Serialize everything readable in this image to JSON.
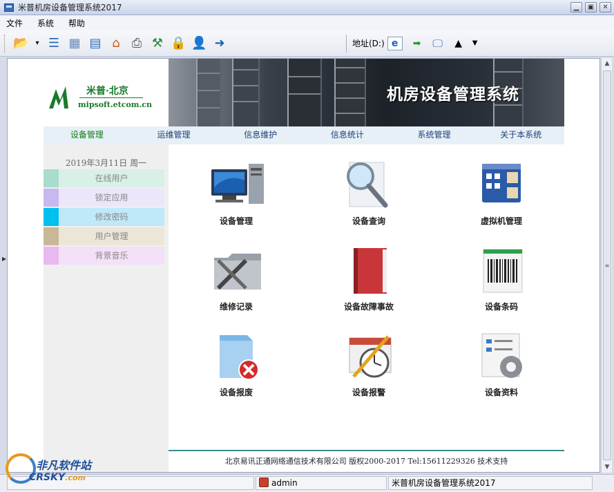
{
  "window": {
    "title": "米普机房设备管理系统2017",
    "buttons": [
      "minimize",
      "maximize",
      "close"
    ]
  },
  "menu": [
    "文件",
    "系统",
    "帮助"
  ],
  "toolbar": {
    "icons": [
      "open-folder-icon",
      "dropdown-icon",
      "list-icon",
      "box-icon",
      "grid-icon",
      "home-icon",
      "print-icon",
      "tools-icon",
      "lock-icon",
      "user-lock-icon",
      "exit-icon"
    ],
    "address_label": "地址(D:)",
    "address_value": "e"
  },
  "logo": {
    "name": "米普·北京",
    "url": "mipsoft.etcom.cn"
  },
  "banner": {
    "title": "机房设备管理系统"
  },
  "nav": [
    "设备管理",
    "运维管理",
    "信息维护",
    "信息统计",
    "系统管理",
    "关于本系统"
  ],
  "sidebar": {
    "date": "2019年3月11日 周一",
    "items": [
      {
        "label": "在线用户",
        "swatch": "#a8dccc",
        "bg": "#d8f0e6"
      },
      {
        "label": "锁定应用",
        "swatch": "#c8b8f0",
        "bg": "#ece6fa"
      },
      {
        "label": "修改密码",
        "swatch": "#00c0ee",
        "bg": "#bfe8f8"
      },
      {
        "label": "用户管理",
        "swatch": "#c8b898",
        "bg": "#ece6d8"
      },
      {
        "label": "背景音乐",
        "swatch": "#e8b8f0",
        "bg": "#f4e0f8"
      }
    ]
  },
  "tiles": [
    {
      "label": "设备管理",
      "icon": "computer-icon"
    },
    {
      "label": "设备查询",
      "icon": "magnifier-icon"
    },
    {
      "label": "虚拟机管理",
      "icon": "virtual-machine-icon"
    },
    {
      "label": "维修记录",
      "icon": "wrench-folder-icon"
    },
    {
      "label": "设备故障事故",
      "icon": "red-notebook-icon"
    },
    {
      "label": "设备条码",
      "icon": "barcode-icon"
    },
    {
      "label": "设备报废",
      "icon": "delete-folder-icon"
    },
    {
      "label": "设备报警",
      "icon": "calendar-clock-icon"
    },
    {
      "label": "设备资料",
      "icon": "settings-document-icon"
    }
  ],
  "footer": "北京易讯正通网络通信技术有限公司 版权2000-2017  Tel:15611229326  技术支持",
  "status": {
    "user": "admin",
    "app": "米普机房设备管理系统2017"
  },
  "watermark": {
    "cn": "非凡软件站",
    "en": "CRSKY",
    "suffix": ".com"
  },
  "colors": {
    "nav_active": "#177a17",
    "nav_text": "#1e3f7a",
    "logo_green": "#1a7a2a"
  }
}
